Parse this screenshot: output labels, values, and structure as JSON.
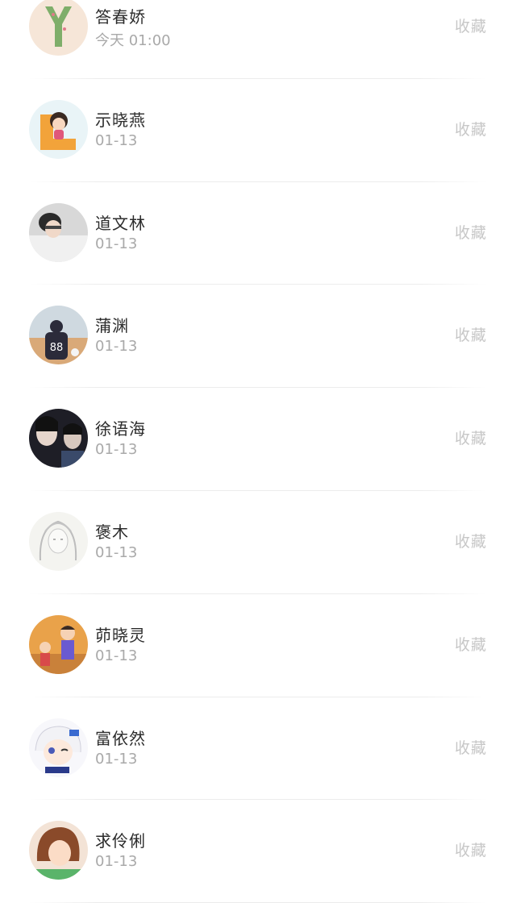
{
  "favorite_list": {
    "items": [
      {
        "name": "答春娇",
        "time": "今天 01:00",
        "action": "收藏",
        "avatar": "letter-y-avatar"
      },
      {
        "name": "示晓燕",
        "time": "01-13",
        "action": "收藏",
        "avatar": "cartoon-girl-letter-l-avatar"
      },
      {
        "name": "道文林",
        "time": "01-13",
        "action": "收藏",
        "avatar": "boy-photo-avatar"
      },
      {
        "name": "蒲渊",
        "time": "01-13",
        "action": "收藏",
        "avatar": "jersey-88-avatar"
      },
      {
        "name": "徐语海",
        "time": "01-13",
        "action": "收藏",
        "avatar": "couple-photo-avatar"
      },
      {
        "name": "褒木",
        "time": "01-13",
        "action": "收藏",
        "avatar": "sketch-girl-avatar"
      },
      {
        "name": "茆晓灵",
        "time": "01-13",
        "action": "收藏",
        "avatar": "cartoon-kids-avatar"
      },
      {
        "name": "富依然",
        "time": "01-13",
        "action": "收藏",
        "avatar": "anime-girl-avatar"
      },
      {
        "name": "求伶俐",
        "time": "01-13",
        "action": "收藏",
        "avatar": "girl-photo-avatar"
      }
    ]
  }
}
